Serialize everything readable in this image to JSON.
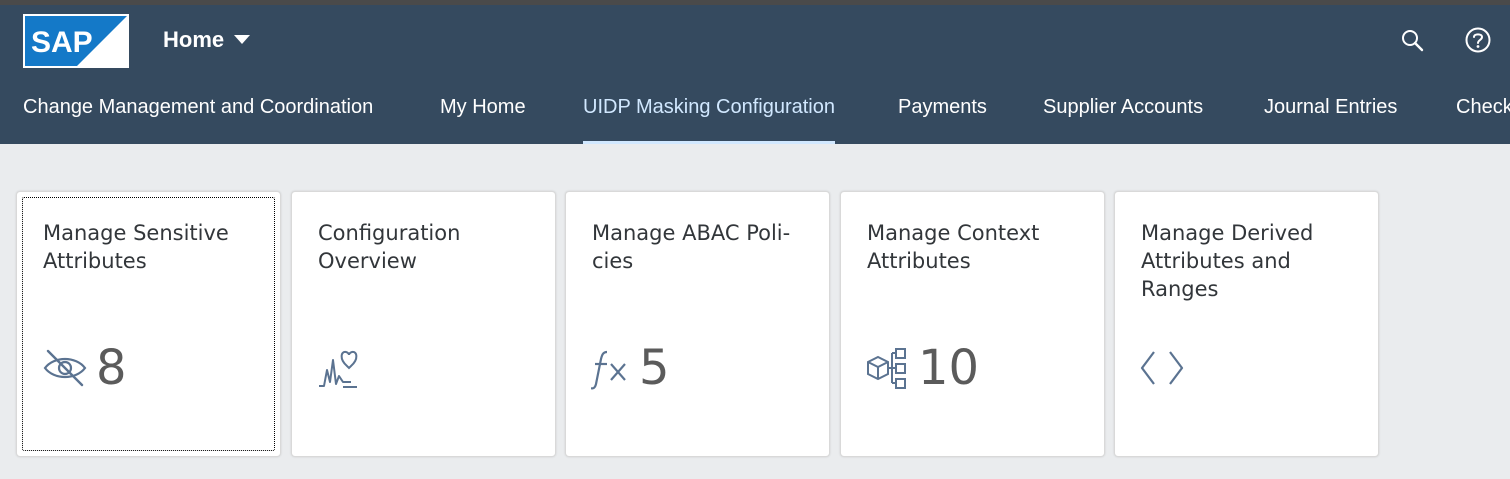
{
  "shell": {
    "logo_text": "SAP",
    "home_label": "Home",
    "icons": [
      "search-icon",
      "help-icon"
    ],
    "colors": {
      "header_bg": "#354a5f",
      "accent": "#d1e8ff",
      "page_bg": "#eaecee",
      "icon": "#5b7391",
      "kpi": "#5b5b5b"
    }
  },
  "tabs": [
    {
      "label": "Change Management and Coordination"
    },
    {
      "label": "My Home"
    },
    {
      "label": "UIDP Masking Configuration",
      "active": true
    },
    {
      "label": "Payments"
    },
    {
      "label": "Supplier Accounts"
    },
    {
      "label": "Journal Entries"
    },
    {
      "label": "Check"
    }
  ],
  "tiles": [
    {
      "title": "Manage Sensitive\nAttributes",
      "icon": "eye-slash-icon",
      "kpi": "8"
    },
    {
      "title": "Configuration\nOverview",
      "icon": "health-chart-icon",
      "kpi": ""
    },
    {
      "title": "Manage ABAC Poli-\ncies",
      "icon": "function-icon",
      "kpi": "5"
    },
    {
      "title": "Manage Context\nAttributes",
      "icon": "hierarchy-cube-icon",
      "kpi": "10"
    },
    {
      "title": "Manage Derived\nAttributes and\nRanges",
      "icon": "code-icon",
      "kpi": ""
    }
  ]
}
